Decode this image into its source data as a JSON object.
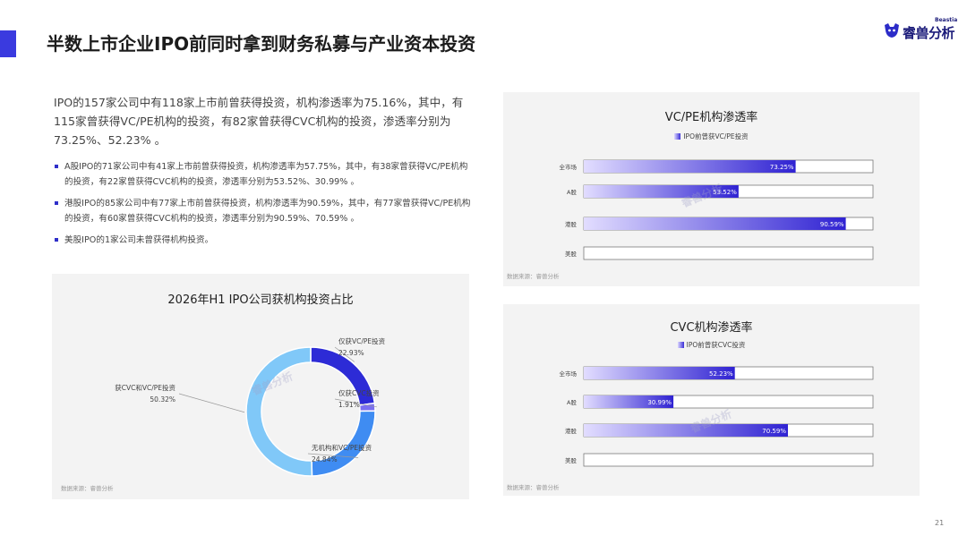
{
  "header": {
    "title": "半数上市企业IPO前同时拿到财务私募与产业资本投资",
    "logo_name": "睿兽分析",
    "logo_sub": "Beastia",
    "page_number": "21"
  },
  "intro": "IPO的157家公司中有118家上市前曾获得投资，机构渗透率为75.16%，其中，有115家曾获得VC/PE机构的投资，有82家曾获得CVC机构的投资，渗透率分别为73.25%、52.23% 。",
  "bullets": [
    "A股IPO的71家公司中有41家上市前曾获得投资，机构渗透率为57.75%，其中，有38家曾获得VC/PE机构的投资，有22家曾获得CVC机构的投资，渗透率分别为53.52%、30.99% 。",
    "港股IPO的85家公司中有77家上市前曾获得投资，机构渗透率为90.59%，其中，有77家曾获得VC/PE机构的投资，有60家曾获得CVC机构的投资，渗透率分别为90.59%、70.59% 。",
    "美股IPO的1家公司未曾获得机构投资。"
  ],
  "watermark": "睿兽分析",
  "colors": {
    "accent": "#3a3adf",
    "bar_start": "#e2ddff",
    "bar_end": "#2f22d2",
    "donut": [
      "#2d2bd6",
      "#7a6ff0",
      "#3f8cf2",
      "#80c8f8"
    ]
  },
  "chart_data": [
    {
      "type": "pie",
      "variant": "donut",
      "title": "2026年H1 IPO公司获机构投资占比",
      "source": "数据来源：睿兽分析",
      "categories": [
        "仅获VC/PE投资",
        "仅获CVC投资",
        "无机构和VC/PE投资",
        "获CVC和VC/PE投资"
      ],
      "labels": [
        "22.93%",
        "1.91%",
        "24.84%",
        "50.32%"
      ],
      "values": [
        22.93,
        1.91,
        24.84,
        50.32
      ]
    },
    {
      "type": "bar",
      "orientation": "horizontal",
      "title": "VC/PE机构渗透率",
      "source": "数据来源：睿兽分析",
      "legend": "IPO前曾获VC/PE投资",
      "categories": [
        "全市场",
        "A股",
        "港股",
        "美股"
      ],
      "values": [
        73.25,
        53.52,
        90.59,
        0
      ],
      "labels": [
        "73.25%",
        "53.52%",
        "90.59%",
        ""
      ],
      "xlim": [
        0,
        100
      ]
    },
    {
      "type": "bar",
      "orientation": "horizontal",
      "title": "CVC机构渗透率",
      "source": "数据来源：睿兽分析",
      "legend": "IPO前曾获CVC投资",
      "categories": [
        "全市场",
        "A股",
        "港股",
        "美股"
      ],
      "values": [
        52.23,
        30.99,
        70.59,
        0
      ],
      "labels": [
        "52.23%",
        "30.99%",
        "70.59%",
        ""
      ],
      "xlim": [
        0,
        100
      ]
    }
  ]
}
